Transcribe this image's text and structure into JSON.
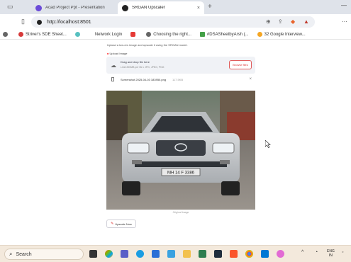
{
  "browser": {
    "tabs": [
      {
        "title": "Acad Project Ppt - Presentation",
        "favicon_color": "#6b4bd8"
      },
      {
        "title": "SRGAN Upscaler",
        "favicon_color": "#222222"
      }
    ],
    "new_tab_symbol": "+",
    "close_symbol": "×",
    "url": "http://localhost:8501",
    "bookmarks": [
      {
        "label": "Striver's SDE Sheet...",
        "color": "#d63a3a"
      },
      {
        "label": "Network Login",
        "color": "#57c0c0"
      },
      {
        "label": "",
        "color": "#9b59b6"
      },
      {
        "label": "",
        "color": "#e53935"
      },
      {
        "label": "Choosing the right...",
        "color": "#666666"
      },
      {
        "label": "#DSASheetbyArsh (...",
        "color": "#43a047"
      },
      {
        "label": "32 Google Interview...",
        "color": "#f5a623"
      }
    ]
  },
  "app": {
    "intro": "Upload a low-res image and upscale it using the SRGAN model.",
    "upload_label": "Upload Image",
    "dropzone": {
      "title": "Drag and drop file here",
      "limit": "Limit 200MB per file • JPG, JPEG, PNG",
      "browse_label": "Browse files"
    },
    "file": {
      "name": "Screenshot 2025-04-03 183950.png",
      "size": "117.5KB",
      "remove_symbol": "×"
    },
    "photo_caption": "Original Image",
    "photo_plate": "MH 14 F 3386",
    "upscale_label": "Upscale Now"
  },
  "taskbar": {
    "search_placeholder": "Search",
    "lang_line1": "ENG",
    "lang_line2": "IN"
  },
  "colors": {
    "tabstrip": "#dfe3ea",
    "accent_red": "#ff4b4b",
    "taskbar": "#f3e9dc"
  }
}
